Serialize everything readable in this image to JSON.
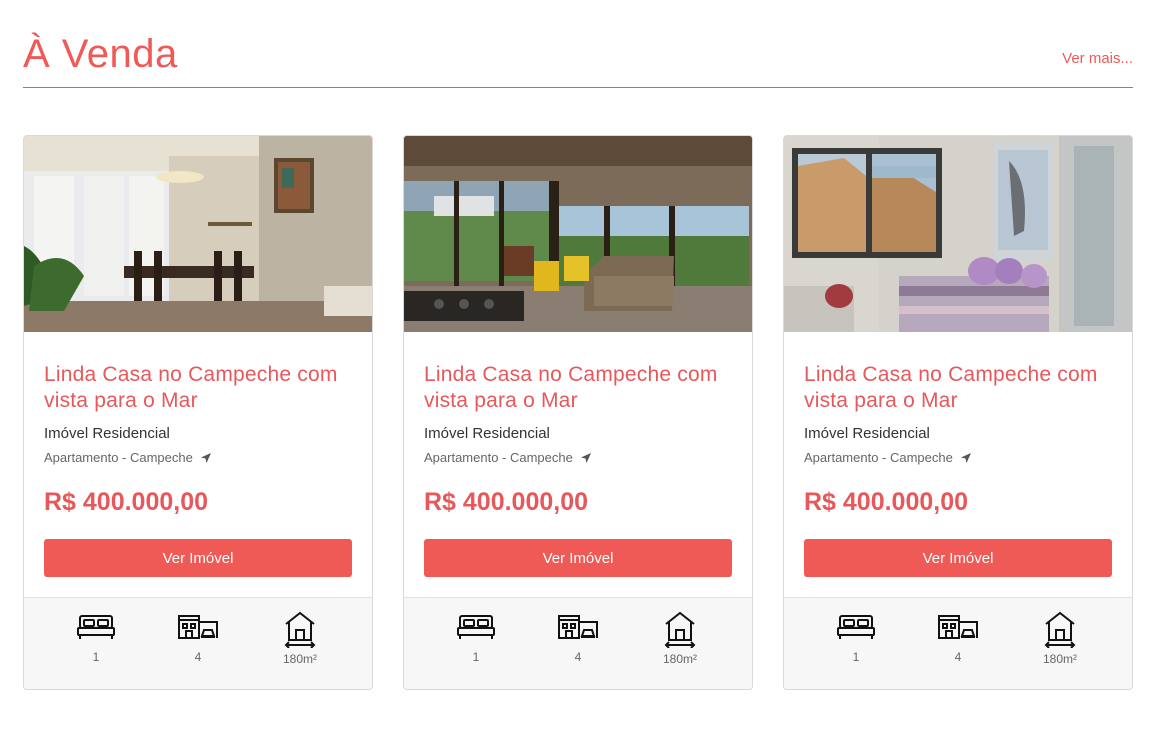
{
  "section": {
    "title": "À Venda",
    "see_more": "Ver mais..."
  },
  "listings": [
    {
      "title": "Linda Casa no Campeche com vista para o Mar",
      "type": "Imóvel Residencial",
      "location": "Apartamento - Campeche",
      "price": "R$ 400.000,00",
      "button_label": "Ver Imóvel",
      "bedrooms": "1",
      "garages": "4",
      "area": "180m²"
    },
    {
      "title": "Linda Casa no Campeche com vista para o Mar",
      "type": "Imóvel Residencial",
      "location": "Apartamento - Campeche",
      "price": "R$ 400.000,00",
      "button_label": "Ver Imóvel",
      "bedrooms": "1",
      "garages": "4",
      "area": "180m²"
    },
    {
      "title": "Linda Casa no Campeche com vista para o Mar",
      "type": "Imóvel Residencial",
      "location": "Apartamento - Campeche",
      "price": "R$ 400.000,00",
      "button_label": "Ver Imóvel",
      "bedrooms": "1",
      "garages": "4",
      "area": "180m²"
    }
  ],
  "icons": {
    "location": "location-arrow-icon",
    "bedrooms": "bed-icon",
    "garages": "garage-icon",
    "area": "house-area-icon"
  },
  "colors": {
    "accent": "#ef5a57",
    "button": "#f05a56",
    "footer_bg": "#f7f7f7"
  }
}
